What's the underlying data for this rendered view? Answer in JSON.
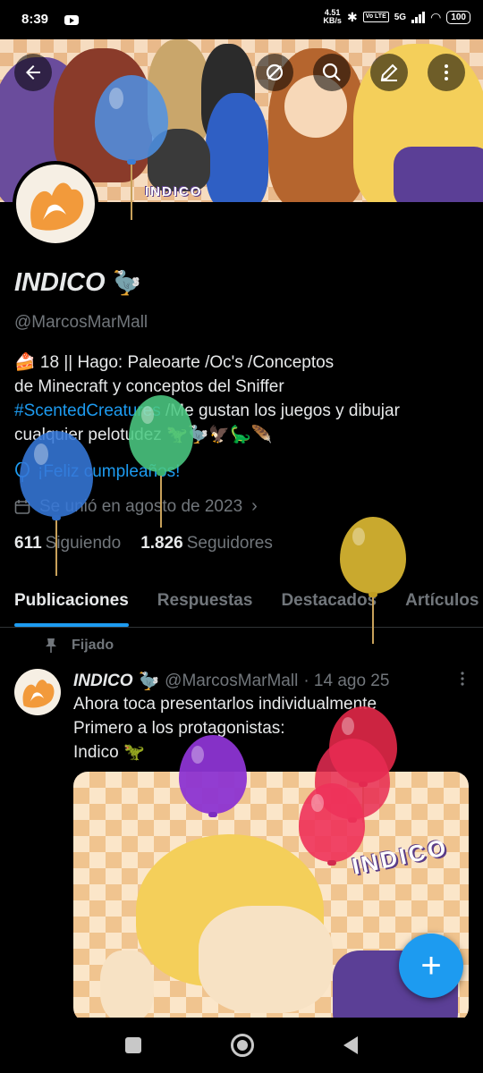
{
  "status_bar": {
    "time": "8:39",
    "net_speed_value": "4.51",
    "net_speed_unit": "KB/s",
    "volte": "Vo LTE",
    "network": "5G",
    "battery": "100"
  },
  "header": {
    "banner_title": "INDICO",
    "back_icon": "arrow-left-icon",
    "grok_icon": "grok-icon",
    "search_icon": "search-icon",
    "edit_icon": "pencil-icon",
    "more_icon": "more-vertical-icon"
  },
  "profile": {
    "name": "INDICO",
    "name_emoji": "🦤",
    "handle": "@MarcosMarMall",
    "bio_line1": "🍰 18 || Hago: Paleoarte /Oc's /Conceptos",
    "bio_line2": "de Minecraft y conceptos del Sniffer",
    "bio_hashtag": "#ScentedCreatures",
    "bio_line3_rest": " /Me gustan los juegos y dibujar",
    "bio_line4": "cualquier pelotudez 🦖🦤🦅🦕🪶",
    "birthday": "¡Feliz cumpleaños!",
    "joined": "Se unió en agosto de 2023",
    "following_count": "611",
    "following_label": "Siguiendo",
    "followers_count": "1.826",
    "followers_label": "Seguidores"
  },
  "tabs": [
    {
      "label": "Publicaciones",
      "active": true
    },
    {
      "label": "Respuestas",
      "active": false
    },
    {
      "label": "Destacados",
      "active": false
    },
    {
      "label": "Artículos",
      "active": false
    }
  ],
  "post": {
    "pinned_label": "Fijado",
    "author_name": "INDICO",
    "author_emoji": "🦤",
    "author_handle": "@MarcosMarMall",
    "date": "· 14 ago 25",
    "line1": "Ahora toca presentarlos individualmente",
    "line2": "Primero a los protagonistas:",
    "line3": "Indico 🦖",
    "media_title": "INDICO"
  },
  "fab": {
    "icon": "plus-icon",
    "label": "+"
  },
  "colors": {
    "accent": "#1d9bf0",
    "text": "#e7e9ea",
    "muted": "#71767b",
    "background": "#000000"
  }
}
